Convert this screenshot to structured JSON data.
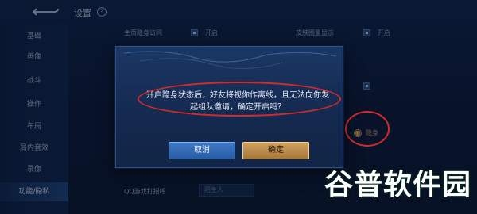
{
  "header": {
    "title": "设置",
    "help_icon": "question-circle-icon",
    "back_icon": "back-arrow-icon"
  },
  "sidebar": {
    "items": [
      {
        "label": "基础",
        "active": false
      },
      {
        "label": "画像",
        "active": false
      },
      {
        "label": "战斗",
        "active": false
      },
      {
        "label": "操作",
        "active": false
      },
      {
        "label": "布局",
        "active": false
      },
      {
        "label": "局内音效",
        "active": false
      },
      {
        "label": "录像",
        "active": false
      },
      {
        "label": "功能/隐私",
        "active": true
      }
    ]
  },
  "settings": {
    "rows": [
      {
        "label": "主页隐身访问",
        "check_label": "开启"
      },
      {
        "label": "皮肤圈量显示",
        "check_label": "开启"
      },
      {
        "label": "QQ游戏打招呼",
        "input_placeholder": "陌生人"
      }
    ],
    "stealth_option": "隐身"
  },
  "dialog": {
    "message_line1": "开启隐身状态后，好友将视你作离线，且无法向你发",
    "message_line2": "起组队邀请，确定开启吗？",
    "cancel_label": "取消",
    "confirm_label": "确定"
  },
  "colors": {
    "accent_blue": "#3e79c4",
    "accent_gold": "#cfa35f",
    "highlight_red": "#d42a2a"
  },
  "watermark": {
    "text": "谷普软件园"
  }
}
